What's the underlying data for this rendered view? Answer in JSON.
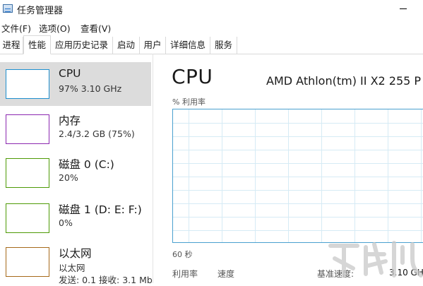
{
  "window": {
    "title": "任务管理器"
  },
  "menu": [
    "文件(F)",
    "选项(O)",
    "查看(V)"
  ],
  "tabs": [
    "进程",
    "性能",
    "应用历史记录",
    "启动",
    "用户",
    "详细信息",
    "服务"
  ],
  "active_tab": "性能",
  "resources": [
    {
      "name": "CPU",
      "detail": "97% 3.10 GHz",
      "color": "#1e8fcf",
      "selected": true
    },
    {
      "name": "内存",
      "detail": "2.4/3.2 GB (75%)",
      "color": "#8b28b0"
    },
    {
      "name": "磁盘 0 (C:)",
      "detail": "20%",
      "color": "#4e9a06"
    },
    {
      "name": "磁盘 1 (D: E: F:)",
      "detail": "0%",
      "color": "#4e9a06"
    },
    {
      "name": "以太网",
      "detail": "以太网",
      "detail2": "发送: 0.1 接收: 3.1 Mb",
      "color": "#a66a1a"
    }
  ],
  "main": {
    "title": "CPU",
    "model": "AMD Athlon(tm) II X2 255 P",
    "util_label": "% 利用率",
    "time_label": "60 秒",
    "utilization_label": "利用率",
    "speed_label": "速度",
    "base_speed_label": "基准速度:",
    "base_speed_value": "3.10 GH"
  },
  "colors": {
    "accent": "#4aa0cf",
    "graph_grid": "#d6ebf5",
    "selected_bg": "#dcdcdc"
  },
  "icons": {
    "app": "task-manager-icon",
    "minimize": "minimize-icon"
  }
}
